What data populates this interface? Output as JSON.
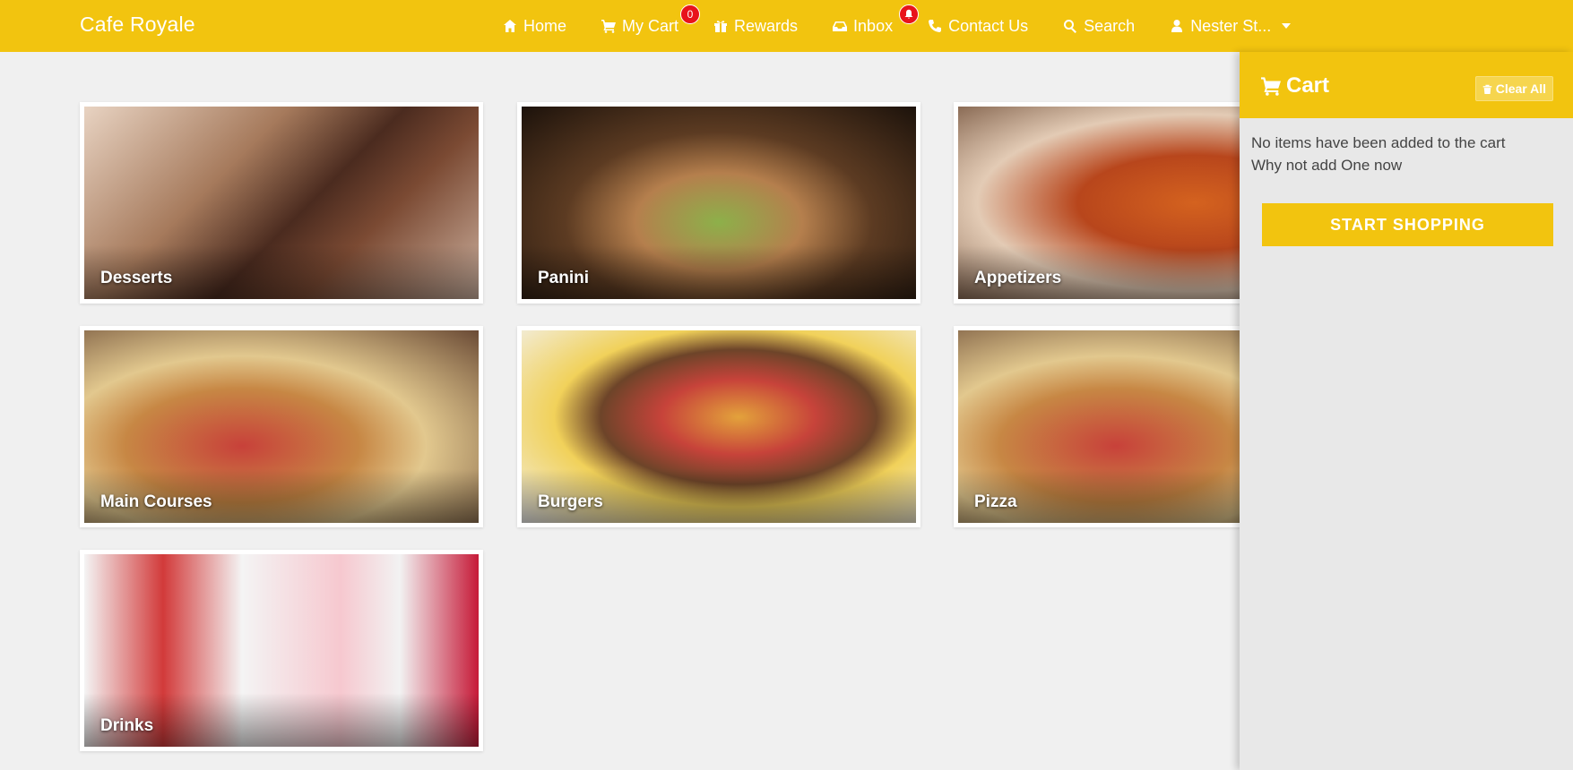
{
  "brand": "Cafe Royale",
  "nav": {
    "home": {
      "label": "Home",
      "icon": "home-icon"
    },
    "cart": {
      "label": "My Cart",
      "icon": "cart-icon",
      "badge": "0"
    },
    "rewards": {
      "label": "Rewards",
      "icon": "gift-icon"
    },
    "inbox": {
      "label": "Inbox",
      "icon": "inbox-icon",
      "badge_icon": "bell-icon"
    },
    "contact": {
      "label": "Contact Us",
      "icon": "phone-icon"
    },
    "search": {
      "label": "Search",
      "icon": "search-icon"
    },
    "user": {
      "label": "Nester St...",
      "icon": "user-icon"
    }
  },
  "categories": [
    {
      "label": "Desserts"
    },
    {
      "label": "Panini"
    },
    {
      "label": "Appetizers"
    },
    {
      "label": "Main Courses"
    },
    {
      "label": "Burgers"
    },
    {
      "label": "Pizza"
    },
    {
      "label": "Drinks"
    }
  ],
  "cart_panel": {
    "title": "Cart",
    "clear_label": "Clear All",
    "empty_line1": "No items have been added to the cart",
    "empty_line2": "Why not add One now",
    "start_label": "START SHOPPING"
  },
  "colors": {
    "accent": "#f2c40f",
    "badge": "#e8131b",
    "background": "#f0f0f0",
    "panel": "#e8e8e8"
  }
}
